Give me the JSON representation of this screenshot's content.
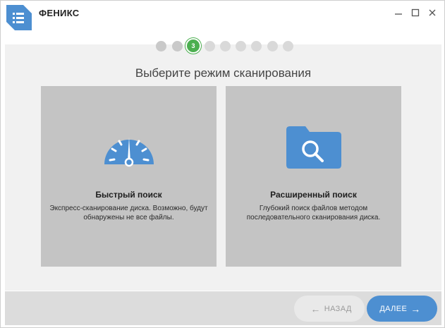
{
  "app": {
    "title": "ФЕНИКС"
  },
  "window_controls": {
    "minimize": "—",
    "maximize": "☐",
    "close": "✕"
  },
  "wizard": {
    "steps_total": 9,
    "current_step": 3,
    "current_step_label": "3"
  },
  "heading": "Выберите режим сканирования",
  "modes": [
    {
      "icon": "speedometer-icon",
      "title": "Быстрый поиск",
      "description": "Экспресс-сканирование диска. Возможно, будут обнаружены не все файлы."
    },
    {
      "icon": "folder-search-icon",
      "title": "Расширенный поиск",
      "description": "Глубокий поиск файлов методом последовательного сканирования диска."
    }
  ],
  "nav": {
    "back_label": "НАЗАД",
    "next_label": "ДАЛЕЕ"
  },
  "colors": {
    "accent": "#4d8fd1",
    "step_active": "#4caf50",
    "card_bg": "#c4c4c4"
  }
}
